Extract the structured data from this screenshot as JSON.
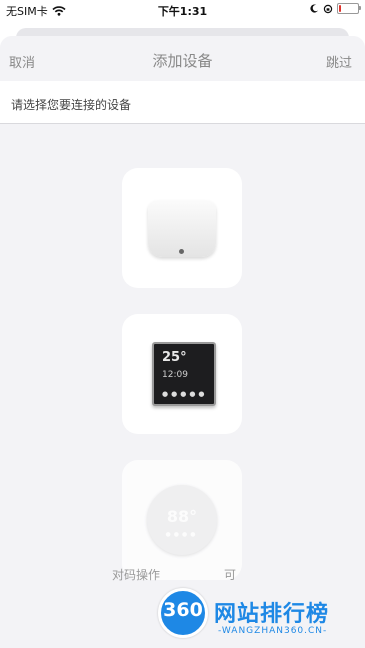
{
  "status": {
    "carrier": "无SIM卡",
    "time": "下午1:31",
    "battery_level": 0.12
  },
  "nav": {
    "cancel": "取消",
    "title": "添加设备",
    "skip": "跳过"
  },
  "prompt": "请选择您要连接的设备",
  "devices": [
    {
      "icon": "smart-hub-icon"
    },
    {
      "icon": "thermostat-display-icon",
      "display_temp": "25°",
      "display_time": "12:09"
    },
    {
      "icon": "round-thermostat-icon",
      "display_value": "88°"
    }
  ],
  "footer_hint": {
    "left": "对码操作",
    "right": "可"
  },
  "watermark": {
    "logo": "360",
    "name": "网站排行榜",
    "domain": "-WANGZHAN360.CN-"
  },
  "colors": {
    "accent": "#1e88e5",
    "battery_low": "#e0332c"
  }
}
